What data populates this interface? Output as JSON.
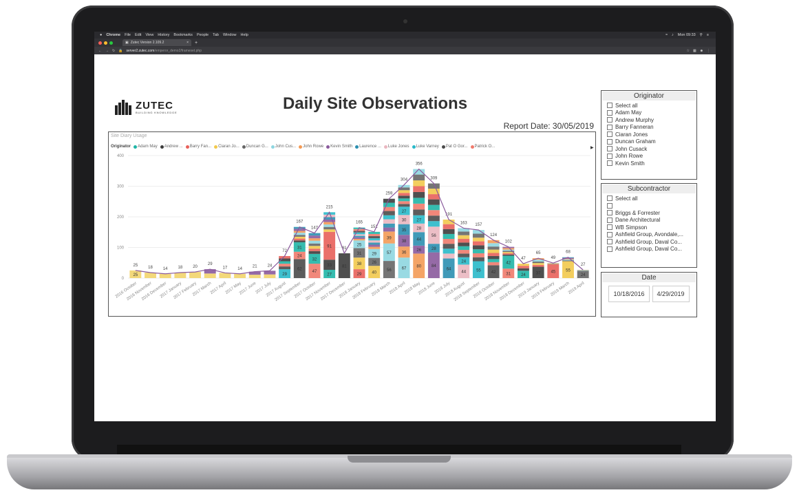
{
  "menubar": {
    "apple": "",
    "items": [
      "Chrome",
      "File",
      "Edit",
      "View",
      "History",
      "Bookmarks",
      "People",
      "Tab",
      "Window",
      "Help"
    ],
    "clock": "Mon 09:33"
  },
  "browser": {
    "tab_title": "Zutec Version 2.109.2",
    "url_host": "server2.zutec.com",
    "url_path": "/emperor_demo2/frameset.php"
  },
  "report": {
    "logo_name": "ZUTEC",
    "logo_tagline": "BUILDING KNOWLEDGE",
    "title": "Daily Site Observations",
    "report_date": "Report Date: 30/05/2019",
    "chart_title": "Site Diary Usage",
    "legend_label": "Originator",
    "legend": [
      {
        "name": "Adam May",
        "color": "#1fb5a6"
      },
      {
        "name": "Andrew ...",
        "color": "#3c3c3c"
      },
      {
        "name": "Barry Fan...",
        "color": "#e8605a"
      },
      {
        "name": "Ciaran Jo...",
        "color": "#f2c94c"
      },
      {
        "name": "Duncan G...",
        "color": "#666666"
      },
      {
        "name": "John Cus...",
        "color": "#8ed6e0"
      },
      {
        "name": "John Rowe",
        "color": "#f39a55"
      },
      {
        "name": "Kevin Smith",
        "color": "#8a5a9c"
      },
      {
        "name": "Laurence ...",
        "color": "#2b8fb0"
      },
      {
        "name": "Luke Jones",
        "color": "#eab7c0"
      },
      {
        "name": "Luke Varney",
        "color": "#29b9c9"
      },
      {
        "name": "Pat O Gor...",
        "color": "#4a4a4a"
      },
      {
        "name": "Patrick O...",
        "color": "#f07a6c"
      }
    ]
  },
  "chart_data": {
    "type": "bar",
    "stacked": true,
    "title": "Site Diary Usage",
    "ylim": [
      0,
      400
    ],
    "yticks": [
      0,
      100,
      200,
      300,
      400
    ],
    "categories": [
      "2016 October",
      "2016 November",
      "2016 December",
      "2017 January",
      "2017 February",
      "2017 March",
      "2017 April",
      "2017 May",
      "2017 June",
      "2017 July",
      "2017 August",
      "2017 September",
      "2017 October",
      "2017 November",
      "2017 December",
      "2018 January",
      "2018 February",
      "2018 March",
      "2018 April",
      "2018 May",
      "2018 June",
      "2018 July",
      "2018 August",
      "2018 September",
      "2018 October",
      "2018 November",
      "2018 December",
      "2019 January",
      "2019 February",
      "2019 March",
      "2019 April"
    ],
    "totals": [
      25,
      18,
      14,
      18,
      20,
      29,
      17,
      14,
      21,
      24,
      72,
      167,
      147,
      215,
      81,
      165,
      151,
      259,
      304,
      356,
      309,
      191,
      163,
      157,
      124,
      102,
      47,
      65,
      49,
      68,
      27
    ],
    "segment_labels": [
      [
        "25"
      ],
      [],
      [],
      [],
      [],
      [],
      [],
      [],
      [],
      [],
      [
        "29"
      ],
      [
        "62",
        "24",
        "31"
      ],
      [
        "47",
        "32"
      ],
      [
        "27",
        "33",
        "91"
      ],
      [
        "81"
      ],
      [
        "29",
        "38",
        "31",
        "25"
      ],
      [
        "40",
        "26",
        "29"
      ],
      [
        "56",
        "57",
        "39"
      ],
      [
        "67",
        "36",
        "38",
        "35",
        "30",
        "27"
      ],
      [
        "80",
        "26",
        "44",
        "28",
        "27"
      ],
      [
        "84",
        "28",
        "56"
      ],
      [
        "64"
      ],
      [
        "44",
        "24"
      ],
      [
        "55"
      ],
      [
        "42"
      ],
      [
        "31",
        "42"
      ],
      [
        "24"
      ],
      [
        "37"
      ],
      [
        "45"
      ],
      [
        "55"
      ],
      [
        "24"
      ]
    ],
    "line_series": "Total"
  },
  "originator_slicer": {
    "title": "Originator",
    "items": [
      "Select all",
      "Adam May",
      "Andrew Murphy",
      "Barry Fanneran",
      "Ciaran Jones",
      "Duncan Graham",
      "John Cusack",
      "John Rowe",
      "Kevin Smith"
    ]
  },
  "subcontractor_slicer": {
    "title": "Subcontractor",
    "items": [
      "Select all",
      "",
      "Briggs & Forrester",
      "Dane Architectural",
      "WB Simpson",
      "Ashfield Group, Avondale,...",
      "Ashfield Group, Daval Co...",
      "Ashfield Group, Daval Co..."
    ]
  },
  "date_slicer": {
    "title": "Date",
    "start": "10/18/2016",
    "end": "4/29/2019"
  }
}
